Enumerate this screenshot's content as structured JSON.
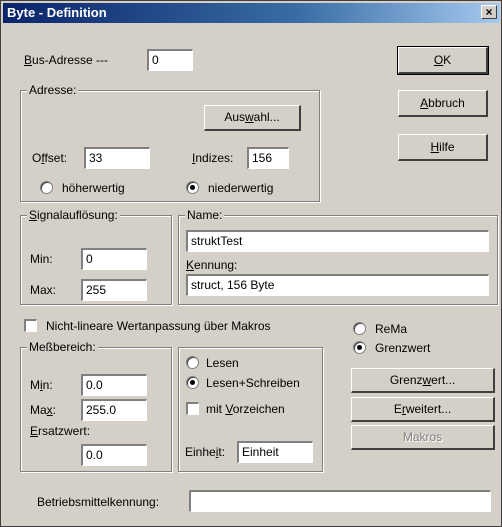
{
  "window": {
    "title": "Byte - Definition",
    "close": "×"
  },
  "bus_address": {
    "label_u": "B",
    "label_rest": "us-Adresse ---",
    "value": "0"
  },
  "buttons": {
    "ok_u": "O",
    "ok_rest": "K",
    "cancel_u": "A",
    "cancel_rest": "bbruch",
    "help_u": "H",
    "help_rest": "ilfe"
  },
  "address": {
    "legend": "Adresse:",
    "select_pre": "Aus",
    "select_u": "w",
    "select_post": "ahl...",
    "offset_pre": "O",
    "offset_u": "f",
    "offset_post": "fset:",
    "offset_value": "33",
    "indices_u": "I",
    "indices_rest": "ndizes:",
    "indices_value": "156",
    "radio_high": "höherwertig",
    "radio_low": "niederwertig",
    "selected": "low"
  },
  "signal": {
    "legend_u": "S",
    "legend_rest": "ignalauflösung:",
    "min_label": "Min:",
    "min_value": "0",
    "max_label": "Max:",
    "max_value": "255"
  },
  "name": {
    "legend": "Name:",
    "name_value": "struktTest",
    "id_u": "K",
    "id_rest": "ennung:",
    "id_value": "struct, 156 Byte"
  },
  "nonlinear": {
    "label": "Nicht-lineare Wertanpassung über Makros",
    "checked": false
  },
  "mode": {
    "rema": "ReMa",
    "limit": "Grenzwert",
    "selected": "limit"
  },
  "measure": {
    "legend": "Meßbereich:",
    "min_pre": "M",
    "min_u": "i",
    "min_post": "n:",
    "min_value": "0.0",
    "max_pre": "Ma",
    "max_u": "x",
    "max_post": ":",
    "max_value": "255.0",
    "sub_u": "E",
    "sub_rest": "rsatzwert:",
    "sub_value": "0.0"
  },
  "access": {
    "read": "Lesen",
    "readwrite": "Lesen+Schreiben",
    "selected": "readwrite",
    "signed_pre": "mit ",
    "signed_u": "V",
    "signed_post": "orzeichen",
    "unit_pre": "Einhe",
    "unit_u": "i",
    "unit_post": "t:",
    "unit_value": "Einheit"
  },
  "side_buttons": {
    "limit_pre": "Grenz",
    "limit_u": "w",
    "limit_post": "ert...",
    "ext_pre": "E",
    "ext_u": "r",
    "ext_post": "weitert...",
    "macros": "Makros"
  },
  "equipment": {
    "label": "Betriebsmittelkennung:",
    "value": ""
  }
}
